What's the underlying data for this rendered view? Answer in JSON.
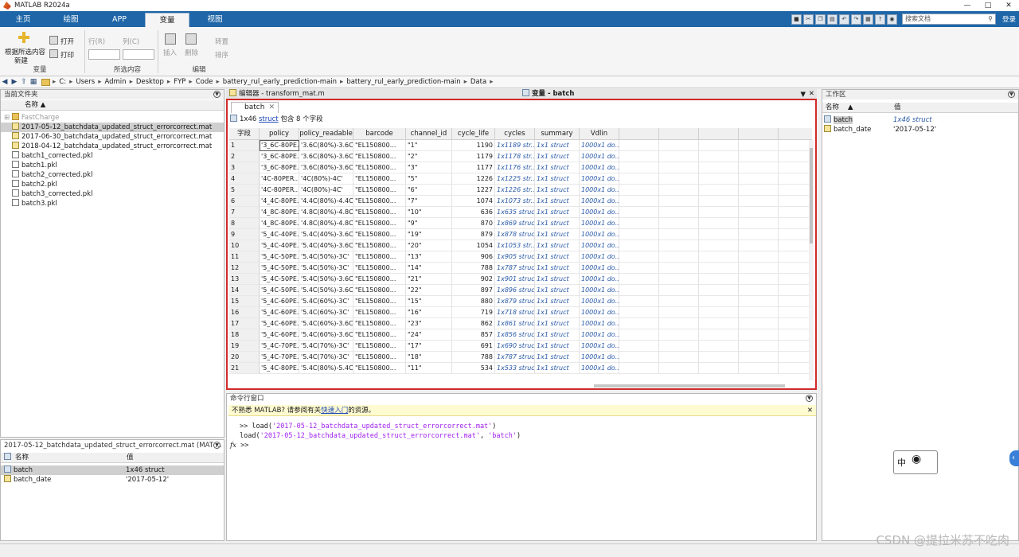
{
  "window": {
    "title": "MATLAB R2024a"
  },
  "tabs": [
    {
      "label": "主页"
    },
    {
      "label": "绘图"
    },
    {
      "label": "APP"
    },
    {
      "label": "变量"
    },
    {
      "label": "视图"
    }
  ],
  "search": {
    "placeholder": "搜索文档"
  },
  "login_label": "登录",
  "ribbon": {
    "new_from_selection": "根据所选内容",
    "new_label": "新建",
    "open": "打开",
    "print": "打印",
    "row": "行(R)",
    "col": "列(C)",
    "insert": "插入",
    "delete": "删除",
    "transpose": "转置",
    "sort": "排序",
    "section_variable": "变量",
    "section_selection": "所选内容",
    "section_edit": "编辑"
  },
  "breadcrumb": [
    "C:",
    "Users",
    "Admin",
    "Desktop",
    "FYP",
    "Code",
    "battery_rul_early_prediction-main",
    "battery_rul_early_prediction-main",
    "Data"
  ],
  "current_folder": {
    "title": "当前文件夹",
    "col_name": "名称",
    "items": [
      {
        "name": "FastCharge",
        "kind": "folder"
      },
      {
        "name": "2017-05-12_batchdata_updated_struct_errorcorrect.mat",
        "kind": "mat"
      },
      {
        "name": "2017-06-30_batchdata_updated_struct_errorcorrect.mat",
        "kind": "mat"
      },
      {
        "name": "2018-04-12_batchdata_updated_struct_errorcorrect.mat",
        "kind": "mat"
      },
      {
        "name": "batch1_corrected.pkl",
        "kind": "file"
      },
      {
        "name": "batch1.pkl",
        "kind": "file"
      },
      {
        "name": "batch2_corrected.pkl",
        "kind": "file"
      },
      {
        "name": "batch2.pkl",
        "kind": "file"
      },
      {
        "name": "batch3_corrected.pkl",
        "kind": "file"
      },
      {
        "name": "batch3.pkl",
        "kind": "file"
      }
    ]
  },
  "details": {
    "title": "2017-05-12_batchdata_updated_struct_errorcorrect.mat  (MAT ...",
    "col_name": "名称",
    "col_value": "值",
    "rows": [
      {
        "name": "batch",
        "value": "1x46 struct"
      },
      {
        "name": "batch_date",
        "value": "'2017-05-12'"
      }
    ]
  },
  "editor_title": "编辑器 - transform_mat.m",
  "variables": {
    "title": "变量 - batch",
    "tab": "batch",
    "info_size": "1x46",
    "info_type": "struct",
    "info_rest": "包含 8 个字段",
    "field_header": "字段",
    "columns": [
      "policy",
      "policy_readable",
      "barcode",
      "channel_id",
      "cycle_life",
      "cycles",
      "summary",
      "Vdlin"
    ],
    "rows": [
      [
        "1",
        "'3_6C-80PE...",
        "'3.6C(80%)-3.6C'",
        "\"EL150800...",
        "\"1\"",
        "1190",
        "1x1189 str...",
        "1x1 struct",
        "1000x1 do..."
      ],
      [
        "2",
        "'3_6C-80PE...",
        "'3.6C(80%)-3.6C'",
        "\"EL150800...",
        "\"2\"",
        "1179",
        "1x1178 str...",
        "1x1 struct",
        "1000x1 do..."
      ],
      [
        "3",
        "'3_6C-80PE...",
        "'3.6C(80%)-3.6C'",
        "\"EL150800...",
        "\"3\"",
        "1177",
        "1x1176 str...",
        "1x1 struct",
        "1000x1 do..."
      ],
      [
        "4",
        "'4C-80PER...",
        "'4C(80%)-4C'",
        "\"EL150800...",
        "\"5\"",
        "1226",
        "1x1225 str...",
        "1x1 struct",
        "1000x1 do..."
      ],
      [
        "5",
        "'4C-80PER...",
        "'4C(80%)-4C'",
        "\"EL150800...",
        "\"6\"",
        "1227",
        "1x1226 str...",
        "1x1 struct",
        "1000x1 do..."
      ],
      [
        "6",
        "'4_4C-80PE...",
        "'4.4C(80%)-4.4C'",
        "\"EL150800...",
        "\"7\"",
        "1074",
        "1x1073 str...",
        "1x1 struct",
        "1000x1 do..."
      ],
      [
        "7",
        "'4_8C-80PE...",
        "'4.8C(80%)-4.8C'",
        "\"EL150800...",
        "\"10\"",
        "636",
        "1x635 struct",
        "1x1 struct",
        "1000x1 do..."
      ],
      [
        "8",
        "'4_8C-80PE...",
        "'4.8C(80%)-4.8C'",
        "\"EL150800...",
        "\"9\"",
        "870",
        "1x869 struct",
        "1x1 struct",
        "1000x1 do..."
      ],
      [
        "9",
        "'5_4C-40PE...",
        "'5.4C(40%)-3.6C'",
        "\"EL150800...",
        "\"19\"",
        "879",
        "1x878 struct",
        "1x1 struct",
        "1000x1 do..."
      ],
      [
        "10",
        "'5_4C-40PE...",
        "'5.4C(40%)-3.6C'",
        "\"EL150800...",
        "\"20\"",
        "1054",
        "1x1053 str...",
        "1x1 struct",
        "1000x1 do..."
      ],
      [
        "11",
        "'5_4C-50PE...",
        "'5.4C(50%)-3C'",
        "\"EL150800...",
        "\"13\"",
        "906",
        "1x905 struct",
        "1x1 struct",
        "1000x1 do..."
      ],
      [
        "12",
        "'5_4C-50PE...",
        "'5.4C(50%)-3C'",
        "\"EL150800...",
        "\"14\"",
        "788",
        "1x787 struct",
        "1x1 struct",
        "1000x1 do..."
      ],
      [
        "13",
        "'5_4C-50PE...",
        "'5.4C(50%)-3.6C'",
        "\"EL150800...",
        "\"21\"",
        "902",
        "1x901 struct",
        "1x1 struct",
        "1000x1 do..."
      ],
      [
        "14",
        "'5_4C-50PE...",
        "'5.4C(50%)-3.6C'",
        "\"EL150800...",
        "\"22\"",
        "897",
        "1x896 struct",
        "1x1 struct",
        "1000x1 do..."
      ],
      [
        "15",
        "'5_4C-60PE...",
        "'5.4C(60%)-3C'",
        "\"EL150800...",
        "\"15\"",
        "880",
        "1x879 struct",
        "1x1 struct",
        "1000x1 do..."
      ],
      [
        "16",
        "'5_4C-60PE...",
        "'5.4C(60%)-3C'",
        "\"EL150800...",
        "\"16\"",
        "719",
        "1x718 struct",
        "1x1 struct",
        "1000x1 do..."
      ],
      [
        "17",
        "'5_4C-60PE...",
        "'5.4C(60%)-3.6C'",
        "\"EL150800...",
        "\"23\"",
        "862",
        "1x861 struct",
        "1x1 struct",
        "1000x1 do..."
      ],
      [
        "18",
        "'5_4C-60PE...",
        "'5.4C(60%)-3.6C'",
        "\"EL150800...",
        "\"24\"",
        "857",
        "1x856 struct",
        "1x1 struct",
        "1000x1 do..."
      ],
      [
        "19",
        "'5_4C-70PE...",
        "'5.4C(70%)-3C'",
        "\"EL150800...",
        "\"17\"",
        "691",
        "1x690 struct",
        "1x1 struct",
        "1000x1 do..."
      ],
      [
        "20",
        "'5_4C-70PE...",
        "'5.4C(70%)-3C'",
        "\"EL150800...",
        "\"18\"",
        "788",
        "1x787 struct",
        "1x1 struct",
        "1000x1 do..."
      ],
      [
        "21",
        "'5_4C-80PE...",
        "'5.4C(80%)-5.4C'",
        "\"EL150800...",
        "\"11\"",
        "534",
        "1x533 struct",
        "1x1 struct",
        "1000x1 do..."
      ]
    ]
  },
  "command_window": {
    "title": "命令行窗口",
    "hint_prefix": "不熟悉 MATLAB? 请参阅有关",
    "hint_link": "快速入门",
    "hint_suffix": "的资源。",
    "line1_prompt": ">> ",
    "line1_fn": "load(",
    "line1_arg": "'2017-05-12_batchdata_updated_struct_errorcorrect.mat'",
    "line1_end": ")",
    "line2_fn": "load(",
    "line2_arg1": "'2017-05-12_batchdata_updated_struct_errorcorrect.mat'",
    "line2_mid": ", ",
    "line2_arg2": "'batch'",
    "line2_end": ")",
    "fx": "fx",
    "prompt": ">>"
  },
  "workspace": {
    "title": "工作区",
    "col_name": "名称",
    "col_value": "值",
    "rows": [
      {
        "name": "batch",
        "value": "1x46 struct"
      },
      {
        "name": "batch_date",
        "value": "'2017-05-12'"
      }
    ]
  },
  "ime_label": "中",
  "watermark": "CSDN @提拉米苏不吃肉"
}
